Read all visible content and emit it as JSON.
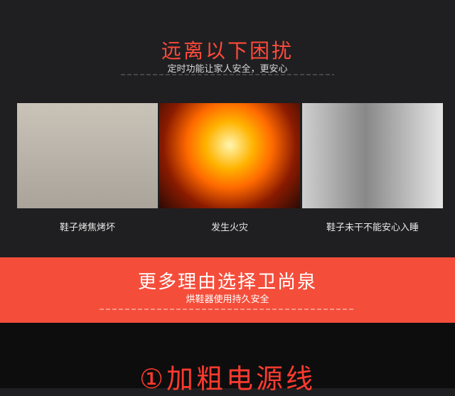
{
  "header": {
    "title": "远离以下困扰",
    "subtitle": "定时功能让家人安全，更安心"
  },
  "photos": [
    {
      "caption": "鞋子烤焦烤坏"
    },
    {
      "caption": "发生火灾"
    },
    {
      "caption": "鞋子未干不能安心入睡"
    }
  ],
  "band": {
    "title": "更多理由选择卫尚泉",
    "subtitle": "烘鞋器使用持久安全"
  },
  "section": {
    "title": "①加粗电源线"
  }
}
